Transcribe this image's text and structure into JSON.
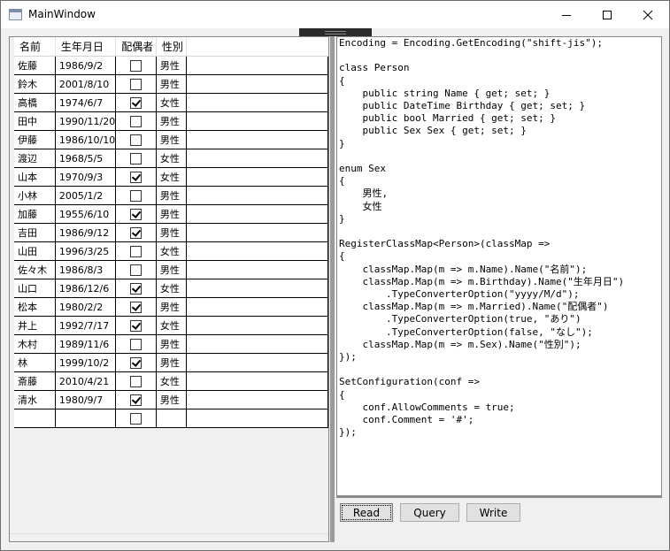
{
  "window": {
    "title": "MainWindow"
  },
  "grid": {
    "columns": [
      "名前",
      "生年月日",
      "配偶者",
      "性別"
    ],
    "rows": [
      {
        "name": "佐藤",
        "birthday": "1986/9/2",
        "married": false,
        "sex": "男性"
      },
      {
        "name": "鈴木",
        "birthday": "2001/8/10",
        "married": false,
        "sex": "男性"
      },
      {
        "name": "高橋",
        "birthday": "1974/6/7",
        "married": true,
        "sex": "女性"
      },
      {
        "name": "田中",
        "birthday": "1990/11/20",
        "married": false,
        "sex": "男性"
      },
      {
        "name": "伊藤",
        "birthday": "1986/10/10",
        "married": false,
        "sex": "男性"
      },
      {
        "name": "渡辺",
        "birthday": "1968/5/5",
        "married": false,
        "sex": "女性"
      },
      {
        "name": "山本",
        "birthday": "1970/9/3",
        "married": true,
        "sex": "女性"
      },
      {
        "name": "小林",
        "birthday": "2005/1/2",
        "married": false,
        "sex": "男性"
      },
      {
        "name": "加藤",
        "birthday": "1955/6/10",
        "married": true,
        "sex": "男性"
      },
      {
        "name": "吉田",
        "birthday": "1986/9/12",
        "married": true,
        "sex": "男性"
      },
      {
        "name": "山田",
        "birthday": "1996/3/25",
        "married": false,
        "sex": "女性"
      },
      {
        "name": "佐々木",
        "birthday": "1986/8/3",
        "married": false,
        "sex": "男性"
      },
      {
        "name": "山口",
        "birthday": "1986/12/6",
        "married": true,
        "sex": "女性"
      },
      {
        "name": "松本",
        "birthday": "1980/2/2",
        "married": true,
        "sex": "男性"
      },
      {
        "name": "井上",
        "birthday": "1992/7/17",
        "married": true,
        "sex": "女性"
      },
      {
        "name": "木村",
        "birthday": "1989/11/6",
        "married": false,
        "sex": "男性"
      },
      {
        "name": "林",
        "birthday": "1999/10/2",
        "married": true,
        "sex": "男性"
      },
      {
        "name": "斎藤",
        "birthday": "2010/4/21",
        "married": false,
        "sex": "女性"
      },
      {
        "name": "清水",
        "birthday": "1980/9/7",
        "married": true,
        "sex": "男性"
      },
      {
        "name": "",
        "birthday": "",
        "married": false,
        "sex": ""
      }
    ]
  },
  "editor": {
    "code": "Encoding = Encoding.GetEncoding(\"shift-jis\");\n\nclass Person\n{\n    public string Name { get; set; }\n    public DateTime Birthday { get; set; }\n    public bool Married { get; set; }\n    public Sex Sex { get; set; }\n}\n\nenum Sex\n{\n    男性,\n    女性\n}\n\nRegisterClassMap<Person>(classMap =>\n{\n    classMap.Map(m => m.Name).Name(\"名前\");\n    classMap.Map(m => m.Birthday).Name(\"生年月日\")\n        .TypeConverterOption(\"yyyy/M/d\");\n    classMap.Map(m => m.Married).Name(\"配偶者\")\n        .TypeConverterOption(true, \"あり\")\n        .TypeConverterOption(false, \"なし\");\n    classMap.Map(m => m.Sex).Name(\"性別\");\n});\n\nSetConfiguration(conf =>\n{\n    conf.AllowComments = true;\n    conf.Comment = '#';\n});"
  },
  "buttons": {
    "read": "Read",
    "query": "Query",
    "write": "Write"
  },
  "icons": {
    "minimize": "minimize-icon",
    "maximize": "maximize-icon",
    "close": "close-icon",
    "app": "window-app-icon"
  }
}
